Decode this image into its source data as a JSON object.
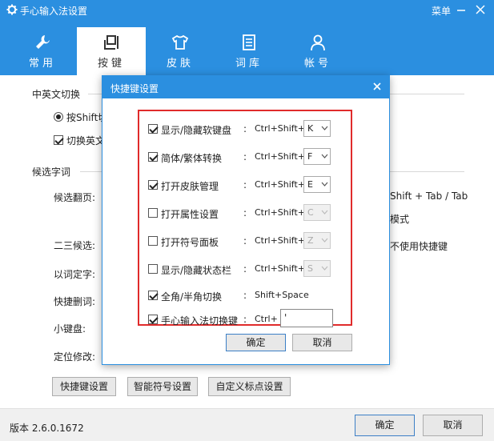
{
  "window": {
    "title": "手心输入法设置",
    "menu_label": "菜单"
  },
  "tabs": [
    {
      "label": "常用",
      "icon": "wrench-icon"
    },
    {
      "label": "按键",
      "icon": "keyboard-icon"
    },
    {
      "label": "皮肤",
      "icon": "shirt-icon"
    },
    {
      "label": "词库",
      "icon": "lexicon-icon"
    },
    {
      "label": "帐号",
      "icon": "user-icon"
    }
  ],
  "main": {
    "section1_title": "中英文切换",
    "radio_partial": "按Shift切",
    "checkbox_partial": "切换英文",
    "section2_title": "候选字词",
    "labels": {
      "page_turn": "候选翻页:",
      "second_third": "二三候选:",
      "word_select": "以词定字:",
      "quick_delete": "快捷删词:",
      "mini_keyboard": "小键盘:",
      "locate_edit": "定位修改:"
    },
    "right_fragments": {
      "shift_tab": "Shift + Tab / Tab",
      "mode": "模式",
      "no_shortcut": "不使用快捷键"
    },
    "buttons": {
      "shortcut_settings": "快捷键设置",
      "smart_symbol": "智能符号设置",
      "custom_punct": "自定义标点设置"
    }
  },
  "footer": {
    "version": "版本 2.6.0.1672",
    "ok": "确定",
    "cancel": "取消"
  },
  "dialog": {
    "title": "快捷键设置",
    "colon": ":",
    "rows": [
      {
        "label": "显示/隐藏软键盘",
        "checked": true,
        "prefix": "Ctrl+Shift+",
        "key": "K",
        "enabled": true
      },
      {
        "label": "简体/繁体转换",
        "checked": true,
        "prefix": "Ctrl+Shift+",
        "key": "F",
        "enabled": true
      },
      {
        "label": "打开皮肤管理",
        "checked": true,
        "prefix": "Ctrl+Shift+",
        "key": "E",
        "enabled": true
      },
      {
        "label": "打开属性设置",
        "checked": false,
        "prefix": "Ctrl+Shift+",
        "key": "C",
        "enabled": false
      },
      {
        "label": "打开符号面板",
        "checked": false,
        "prefix": "Ctrl+Shift+",
        "key": "Z",
        "enabled": false
      },
      {
        "label": "显示/隐藏状态栏",
        "checked": false,
        "prefix": "Ctrl+Shift+",
        "key": "S",
        "enabled": false
      },
      {
        "label": "全角/半角切换",
        "checked": true,
        "prefix": "Shift+Space"
      },
      {
        "label": "手心输入法切换键",
        "checked": true,
        "prefix": "Ctrl+",
        "key": "'"
      }
    ],
    "ok": "确定",
    "cancel": "取消"
  },
  "colors": {
    "accent": "#2b8fe0",
    "highlight": "#e02b2b"
  }
}
